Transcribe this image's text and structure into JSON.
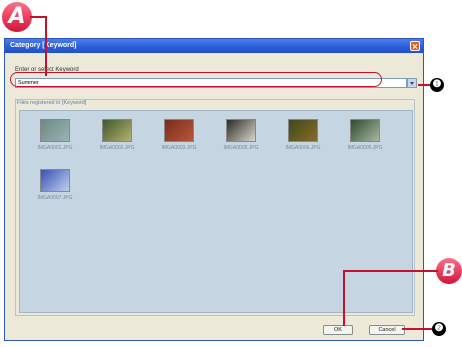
{
  "dialog": {
    "title": "Category [Keyword]",
    "keyword_label": "Enter or select Keyword",
    "keyword_value": "Summer",
    "files_label": "Files registered in [Keyword]",
    "ok_label": "OK",
    "cancel_label": "Cancel"
  },
  "thumbnails": [
    {
      "name": "IMGA0001.JPG",
      "colors": [
        "#6c8a7e",
        "#9ab2b8"
      ]
    },
    {
      "name": "IMGA0002.JPG",
      "colors": [
        "#3e5a2c",
        "#b7b070"
      ]
    },
    {
      "name": "IMGA0003.JPG",
      "colors": [
        "#7a2b1c",
        "#b9573a"
      ]
    },
    {
      "name": "IMGA0005.JPG",
      "colors": [
        "#2c2a24",
        "#d9d6cc"
      ]
    },
    {
      "name": "IMGA0006.JPG",
      "colors": [
        "#3c4a1a",
        "#8c6a2a"
      ]
    },
    {
      "name": "IMGA0005.JPG",
      "colors": [
        "#2e4a2e",
        "#a8b8a0"
      ]
    },
    {
      "name": "IMGA0007.JPG",
      "colors": [
        "#3552b0",
        "#c0cfee"
      ]
    }
  ],
  "callouts": {
    "a": "A",
    "b": "B",
    "one": "❶",
    "two": "❷"
  },
  "colors": {
    "callout_red": "#c8102e",
    "titlebar_blue": "#2a5bd8"
  }
}
